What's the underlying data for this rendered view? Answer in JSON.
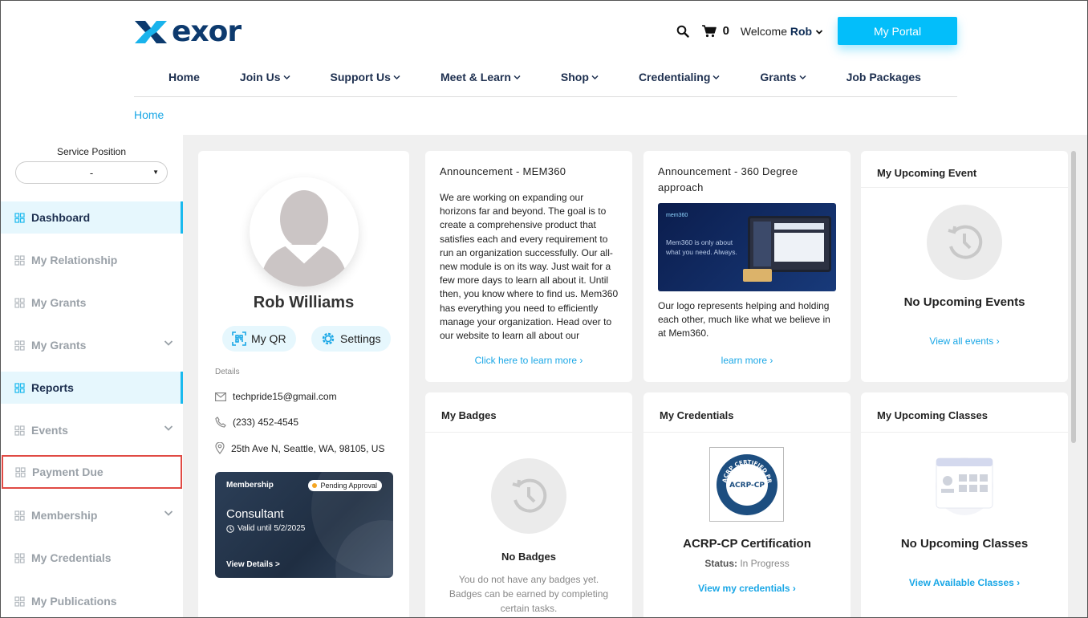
{
  "header": {
    "logo_text": "exor",
    "cart_count": "0",
    "welcome_prefix": "Welcome",
    "user_name": "Rob",
    "portal_button": "My Portal"
  },
  "nav": [
    "Home",
    "Join Us",
    "Support Us",
    "Meet & Learn",
    "Shop",
    "Credentialing",
    "Grants",
    "Job Packages"
  ],
  "breadcrumb": "Home",
  "sidebar": {
    "service_label": "Service Position",
    "service_value": "-",
    "items": [
      "Dashboard",
      "My Relationship",
      "My Grants",
      "My Grants",
      "Reports",
      "Events",
      "Payment Due",
      "Membership",
      "My Credentials",
      "My Publications"
    ]
  },
  "profile": {
    "name": "Rob Williams",
    "qr_label": "My QR",
    "settings_label": "Settings",
    "details_label": "Details",
    "email": "techpride15@gmail.com",
    "phone": "(233) 452-4545",
    "address": "25th Ave N, Seattle, WA, 98105, US",
    "membership": {
      "label": "Membership",
      "status": "Pending Approval",
      "type": "Consultant",
      "valid": "Valid until 5/2/2025",
      "view": "View Details >"
    }
  },
  "announcement1": {
    "title": "Announcement - MEM360",
    "body": "We are working on expanding our horizons far and beyond. The goal is to create a comprehensive product that satisfies each and every requirement to run an organization successfully. Our all-new module is on its way. Just wait for a few more days to learn all about it. Until then, you know where to find us. Mem360 has everything you need to efficiently manage your organization. Head over to our website to learn all about our produc...",
    "link": "Click here to learn more ›"
  },
  "announcement2": {
    "title_line1": "Announcement - 360 Degree",
    "title_line2": "approach",
    "image_brand": "mem360",
    "image_text_line1": "Mem360 is only about",
    "image_text_line2": "what you need. Always.",
    "body": "Our logo represents helping and holding each other, much like what we believe in at Mem360.",
    "link": "learn more ›"
  },
  "upcoming_event": {
    "title": "My Upcoming Event",
    "empty": "No Upcoming Events",
    "link": "View all events ›"
  },
  "badges": {
    "title": "My Badges",
    "empty": "No Badges",
    "desc_line1": "You do not have any badges yet.",
    "desc_line2": "Badges can be earned by completing",
    "desc_line3": "certain tasks."
  },
  "credentials": {
    "title": "My Credentials",
    "seal_ring_text": "ACRP CERTIFIED PROFESSIONAL",
    "seal_center_text": "ACRP-CP",
    "cert_name": "ACRP-CP Certification",
    "status_label": "Status:",
    "status_value": "In Progress",
    "link": "View my credentials ›"
  },
  "classes": {
    "title": "My Upcoming Classes",
    "empty": "No Upcoming Classes",
    "link": "View Available Classes ›"
  },
  "colors": {
    "accent": "#03befa",
    "link": "#1aa7e6",
    "navy": "#0d3a6e",
    "active_bg": "#e6f7fd",
    "highlight": "#e04a44"
  }
}
